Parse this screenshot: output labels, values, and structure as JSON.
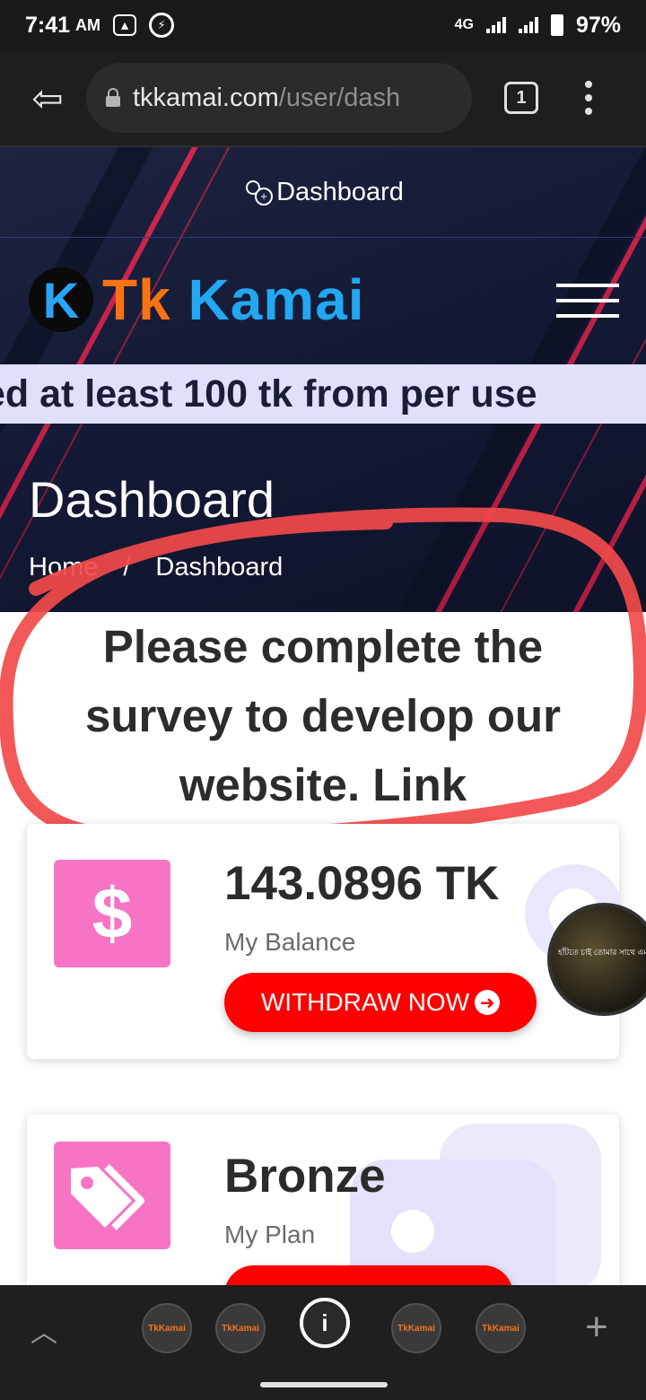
{
  "status_bar": {
    "time": "7:41",
    "ampm": "AM",
    "network": "4G",
    "battery": "97%"
  },
  "browser": {
    "url_host": "tkkamai.com",
    "url_path": "/user/dash",
    "tab_count": "1"
  },
  "site": {
    "top_link": "Dashboard",
    "brand_tk": "Tk",
    "brand_kamai": "Kamai",
    "logo_letter": "K",
    "marquee": "ed at least 100 tk from per use",
    "page_title": "Dashboard",
    "breadcrumb": {
      "home": "Home",
      "separator": "/",
      "current": "Dashboard"
    },
    "notice": "Please complete the survey to develop our website. Link"
  },
  "cards": {
    "balance": {
      "icon_symbol": "$",
      "value": "143.0896 TK",
      "label": "My Balance",
      "button": "WITHDRAW NOW"
    },
    "plan": {
      "value": "Bronze",
      "label": "My Plan"
    }
  },
  "bubble": {
    "caption": "হাঁটতে চাই তোমার সাথে এমন একটি রাতে"
  },
  "tab_strip": {
    "thumb_label": "TkKamai",
    "active_glyph": "i"
  },
  "colors": {
    "accent_red": "#ff0000",
    "icon_pink": "#f774c4",
    "brand_orange": "#f97316",
    "brand_blue": "#22a7f0",
    "hero_bg": "#151a35"
  }
}
